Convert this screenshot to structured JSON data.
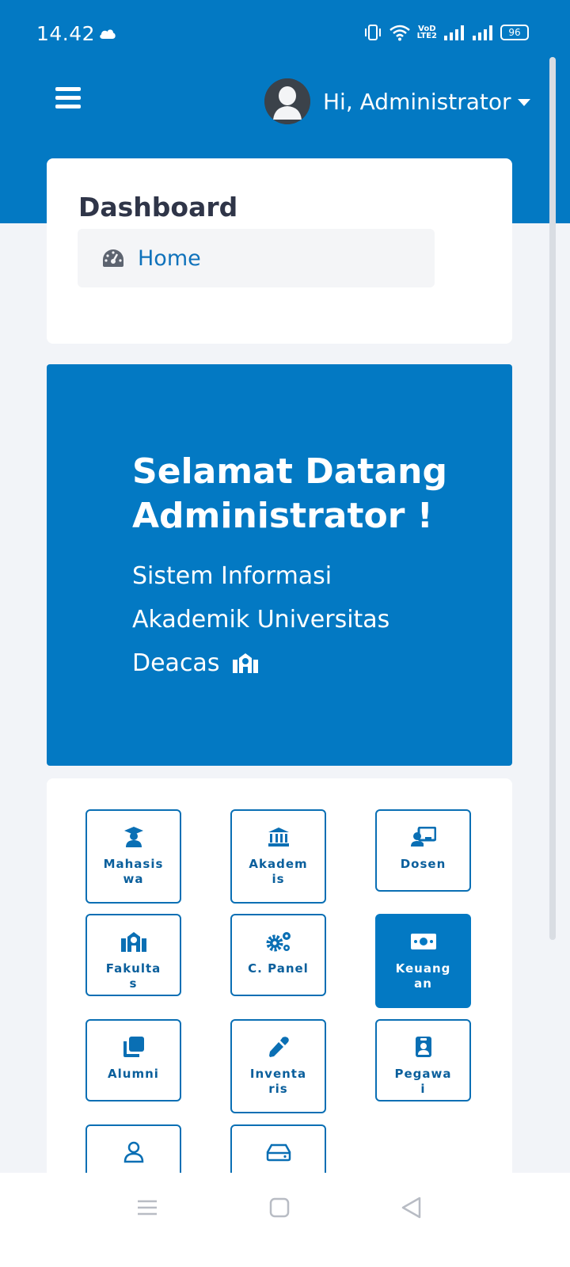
{
  "status_bar": {
    "time": "14.42",
    "battery": "96",
    "volte_top": "VoD",
    "volte_bottom": "LTE2"
  },
  "header": {
    "greeting": "Hi, Administrator"
  },
  "dashboard": {
    "title": "Dashboard",
    "breadcrumb": "Home"
  },
  "hero": {
    "title": "Selamat Datang Administrator !",
    "subtitle": "Sistem Informasi Akademik Universitas Deacas"
  },
  "menu": {
    "tiles": [
      {
        "label": "Mahasiswa",
        "icon": "graduate-icon"
      },
      {
        "label": "Akademis",
        "icon": "institution-icon"
      },
      {
        "label": "Dosen",
        "icon": "teacher-icon"
      },
      {
        "label": "Fakultas",
        "icon": "school-icon"
      },
      {
        "label": "C. Panel",
        "icon": "gears-icon"
      },
      {
        "label": "Keuangan",
        "icon": "money-icon",
        "active": true
      },
      {
        "label": "Alumni",
        "icon": "clone-icon"
      },
      {
        "label": "Inventaris",
        "icon": "eyedropper-icon"
      },
      {
        "label": "Pegawai",
        "icon": "id-badge-icon"
      },
      {
        "label": "",
        "icon": "user-icon"
      },
      {
        "label": "",
        "icon": "hdd-icon"
      }
    ]
  },
  "colors": {
    "primary": "#0379c3",
    "background": "#f2f4f8",
    "title": "#2f3548"
  }
}
